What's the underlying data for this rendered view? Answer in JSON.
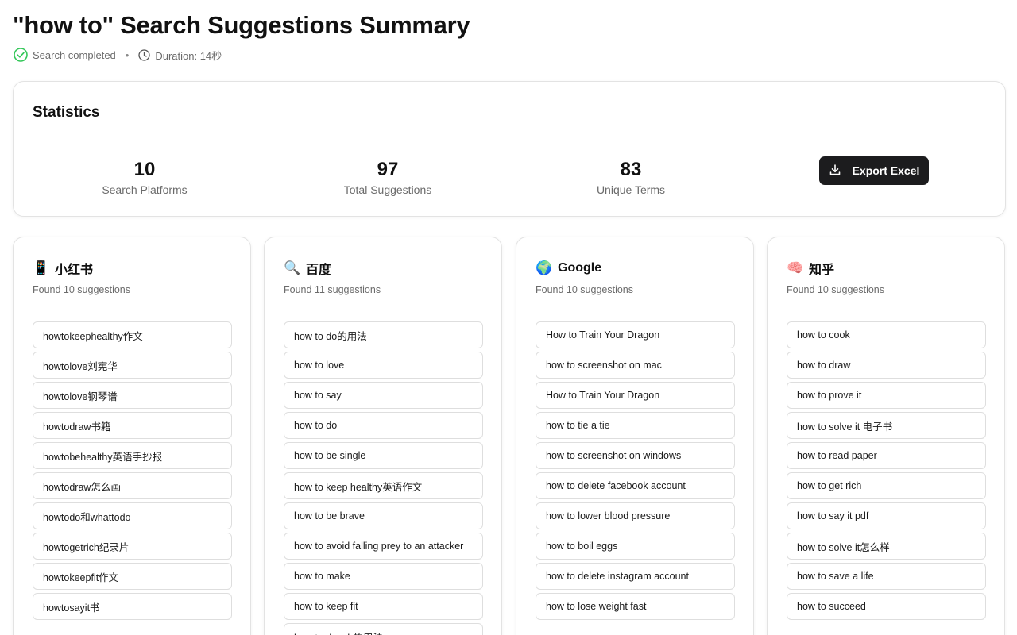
{
  "header": {
    "title": "\"how to\" Search Suggestions Summary",
    "status": "Search completed",
    "separator": "•",
    "duration": "Duration: 14秒",
    "status_color": "#34c759"
  },
  "stats": {
    "title": "Statistics",
    "items": [
      {
        "value": "10",
        "label": "Search Platforms"
      },
      {
        "value": "97",
        "label": "Total Suggestions"
      },
      {
        "value": "83",
        "label": "Unique Terms"
      }
    ],
    "export_label": "Export Excel"
  },
  "platforms": [
    {
      "emoji": "📱",
      "icon": "phone-icon",
      "name": "小红书",
      "count_text": "Found 10 suggestions",
      "suggestions": [
        "howtokeephealthy作文",
        "howtolove刘宪华",
        "howtolove钢琴谱",
        "howtodraw书籍",
        "howtobehealthy英语手抄报",
        "howtodraw怎么画",
        "howtodo和whattodo",
        "howtogetrich纪录片",
        "howtokeepfit作文",
        "howtosayit书"
      ]
    },
    {
      "emoji": "🔍",
      "icon": "magnifier-icon",
      "name": "百度",
      "count_text": "Found 11 suggestions",
      "suggestions": [
        "how to do的用法",
        "how to love",
        "how to say",
        "how to do",
        "how to be single",
        "how to keep healthy英语作文",
        "how to be brave",
        "how to avoid falling prey to an attacker",
        "how to make",
        "how to keep fit",
        "how to do sth的用法"
      ]
    },
    {
      "emoji": "🌍",
      "icon": "globe-icon",
      "name": "Google",
      "count_text": "Found 10 suggestions",
      "suggestions": [
        "How to Train Your Dragon",
        "how to screenshot on mac",
        "How to Train Your Dragon",
        "how to tie a tie",
        "how to screenshot on windows",
        "how to delete facebook account",
        "how to lower blood pressure",
        "how to boil eggs",
        "how to delete instagram account",
        "how to lose weight fast"
      ]
    },
    {
      "emoji": "🧠",
      "icon": "brain-icon",
      "name": "知乎",
      "count_text": "Found 10 suggestions",
      "suggestions": [
        "how to cook",
        "how to draw",
        "how to prove it",
        "how to solve it 电子书",
        "how to read paper",
        "how to get rich",
        "how to say it pdf",
        "how to solve it怎么样",
        "how to save a life",
        "how to succeed"
      ]
    }
  ]
}
